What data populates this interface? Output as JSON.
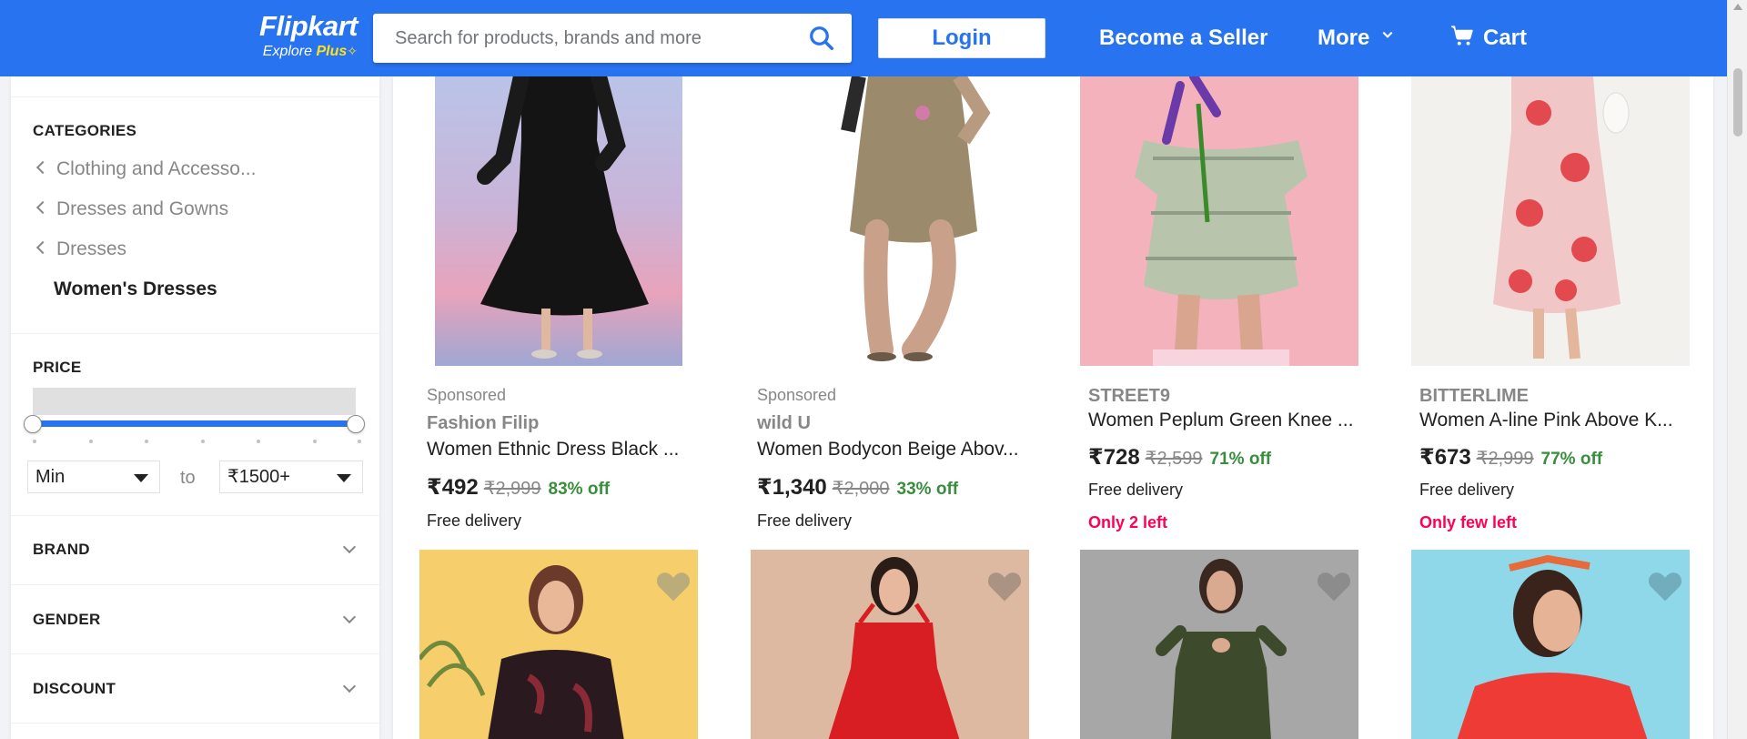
{
  "header": {
    "logo_text": "Flipkart",
    "logo_sub": "Explore",
    "logo_plus": "Plus",
    "logo_colors": {
      "primary": "#2874f0",
      "accent": "#ffe11b"
    },
    "search_placeholder": "Search for products, brands and more",
    "login_label": "Login",
    "seller_label": "Become a Seller",
    "more_label": "More",
    "cart_label": "Cart"
  },
  "sidebar": {
    "categories_heading": "CATEGORIES",
    "category_path": [
      {
        "label": "Clothing and Accesso..."
      },
      {
        "label": "Dresses and Gowns"
      },
      {
        "label": "Dresses"
      }
    ],
    "current_category": "Women's Dresses",
    "price_heading": "PRICE",
    "price_min": "Min",
    "price_to": "to",
    "price_max": "₹1500+",
    "filters": [
      {
        "label": "BRAND"
      },
      {
        "label": "GENDER"
      },
      {
        "label": "DISCOUNT"
      }
    ]
  },
  "products": [
    {
      "sponsored": "Sponsored",
      "brand": "Fashion Filip",
      "title": "Women Ethnic Dress Black ...",
      "price": "₹492",
      "mrp": "₹2,999",
      "off": "83% off",
      "delivery": "Free delivery",
      "stock": ""
    },
    {
      "sponsored": "Sponsored",
      "brand": "wild U",
      "title": "Women Bodycon Beige Abov...",
      "price": "₹1,340",
      "mrp": "₹2,000",
      "off": "33% off",
      "delivery": "Free delivery",
      "stock": ""
    },
    {
      "sponsored": "",
      "brand": "STREET9",
      "title": "Women Peplum Green Knee ...",
      "price": "₹728",
      "mrp": "₹2,599",
      "off": "71% off",
      "delivery": "Free delivery",
      "stock": "Only 2 left"
    },
    {
      "sponsored": "",
      "brand": "BITTERLIME",
      "title": "Women A-line Pink Above K...",
      "price": "₹673",
      "mrp": "₹2,999",
      "off": "77% off",
      "delivery": "Free delivery",
      "stock": "Only few left"
    }
  ],
  "colors": {
    "discount_green": "#388e3c",
    "stock_pink": "#ff0056",
    "brand_blue": "#2874f0"
  },
  "icons": [
    "search-icon",
    "chevron-down-icon",
    "cart-icon",
    "chevron-left-icon",
    "heart-icon"
  ]
}
